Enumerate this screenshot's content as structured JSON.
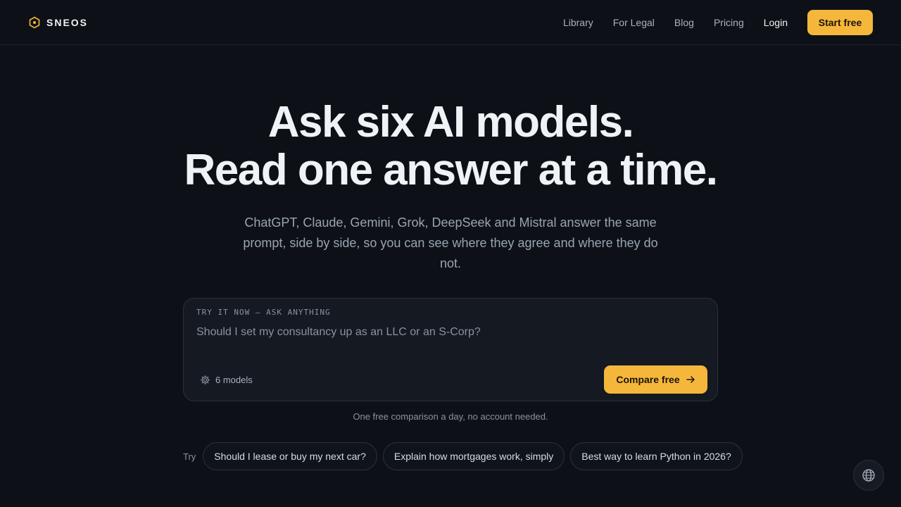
{
  "brand": {
    "name": "SNEOS",
    "accent": "#f5b73b"
  },
  "nav": {
    "links": [
      "Library",
      "For Legal",
      "Blog",
      "Pricing"
    ],
    "login": "Login",
    "cta": "Start free"
  },
  "hero": {
    "headline_line1": "Ask six AI models.",
    "headline_line2": "Read one answer at a time.",
    "subhead": "ChatGPT, Claude, Gemini, Grok, DeepSeek and Mistral answer the same prompt, side by side, so you can see where they agree and where they do not."
  },
  "prompt_card": {
    "label": "TRY IT NOW — ASK ANYTHING",
    "placeholder": "Should I set my consultancy up as an LLC or an S-Corp?",
    "models_label": "6 models",
    "submit_label": "Compare free"
  },
  "note": "One free comparison a day, no account needed.",
  "try": {
    "label": "Try",
    "chips": [
      "Should I lease or buy my next car?",
      "Explain how mortgages work, simply",
      "Best way to learn Python in 2026?"
    ]
  },
  "icons": {
    "brand": "hexagon-logo-icon",
    "models": "gear-icon",
    "submit": "arrow-right-icon",
    "language": "globe-icon"
  },
  "colors": {
    "background": "#0d1117",
    "card": "#141922",
    "accent": "#f5b73b"
  }
}
